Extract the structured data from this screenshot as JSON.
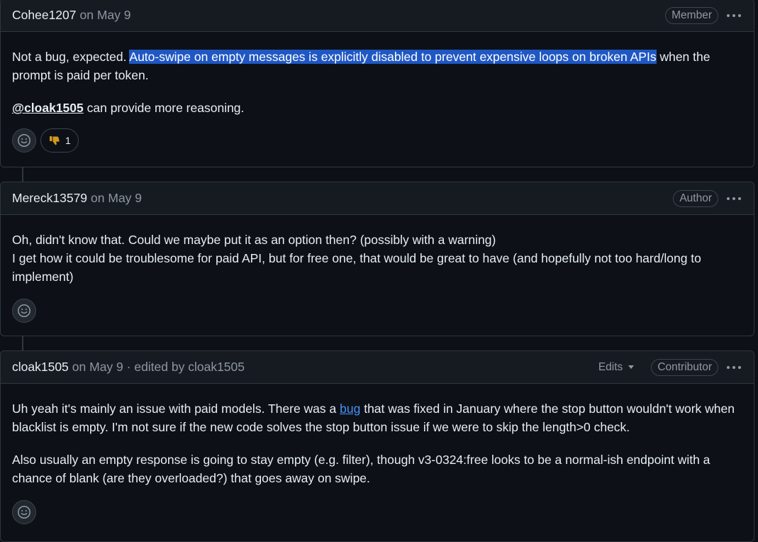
{
  "comments": [
    {
      "author": "Cohee1207",
      "meta": "on May 9",
      "role": "Member",
      "body": {
        "p1_pre": "Not a bug, expected. ",
        "p1_highlight": "Auto-swipe on empty messages is explicitly disabled to prevent expensive loops on broken APIs",
        "p1_post": " when the prompt is paid per token.",
        "mention": "@cloak1505",
        "p2_post": " can provide more reasoning."
      },
      "reactions": [
        {
          "icon": "thumbs-down-icon",
          "count": "1"
        }
      ]
    },
    {
      "author": "Mereck13579",
      "meta": "on May 9",
      "role": "Author",
      "body": {
        "line1": "Oh, didn't know that. Could we maybe put it as an option then? (possibly with a warning)",
        "line2": "I get how it could be troublesome for paid API, but for free one, that would be great to have (and hopefully not too hard/long to implement)"
      }
    },
    {
      "author": "cloak1505",
      "meta": "on May 9 · edited by cloak1505",
      "edits_label": "Edits",
      "role": "Contributor",
      "body": {
        "p1_pre": "Uh yeah it's mainly an issue with paid models. There was a ",
        "p1_link": "bug",
        "p1_post": " that was fixed in January where the stop button wouldn't work when blacklist is empty. I'm not sure if the new code solves the stop button issue if we were to skip the length>0 check.",
        "p2": "Also usually an empty response is going to stay empty (e.g. filter), though v3-0324:free looks to be a normal-ish endpoint with a chance of blank (are they overloaded?) that goes away on swipe."
      }
    }
  ],
  "colors": {
    "background": "#0d1117",
    "header": "#161b22",
    "border": "#30363d",
    "highlight": "#1f57c3",
    "link": "#4493f8"
  }
}
